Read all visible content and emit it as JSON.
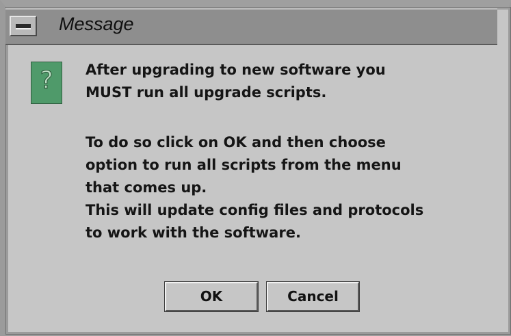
{
  "window": {
    "title": "Message"
  },
  "icon": {
    "name": "question-icon",
    "glyph": "?",
    "color": "#4f9a6a"
  },
  "message": {
    "lines": [
      "After upgrading to new software you",
      "MUST run all upgrade scripts.",
      "To do so click on OK and then choose",
      "option to run all scripts from the menu",
      "that comes up.",
      "This will update config files and protocols",
      "to work with the software."
    ]
  },
  "buttons": {
    "ok_label": "OK",
    "cancel_label": "Cancel"
  }
}
